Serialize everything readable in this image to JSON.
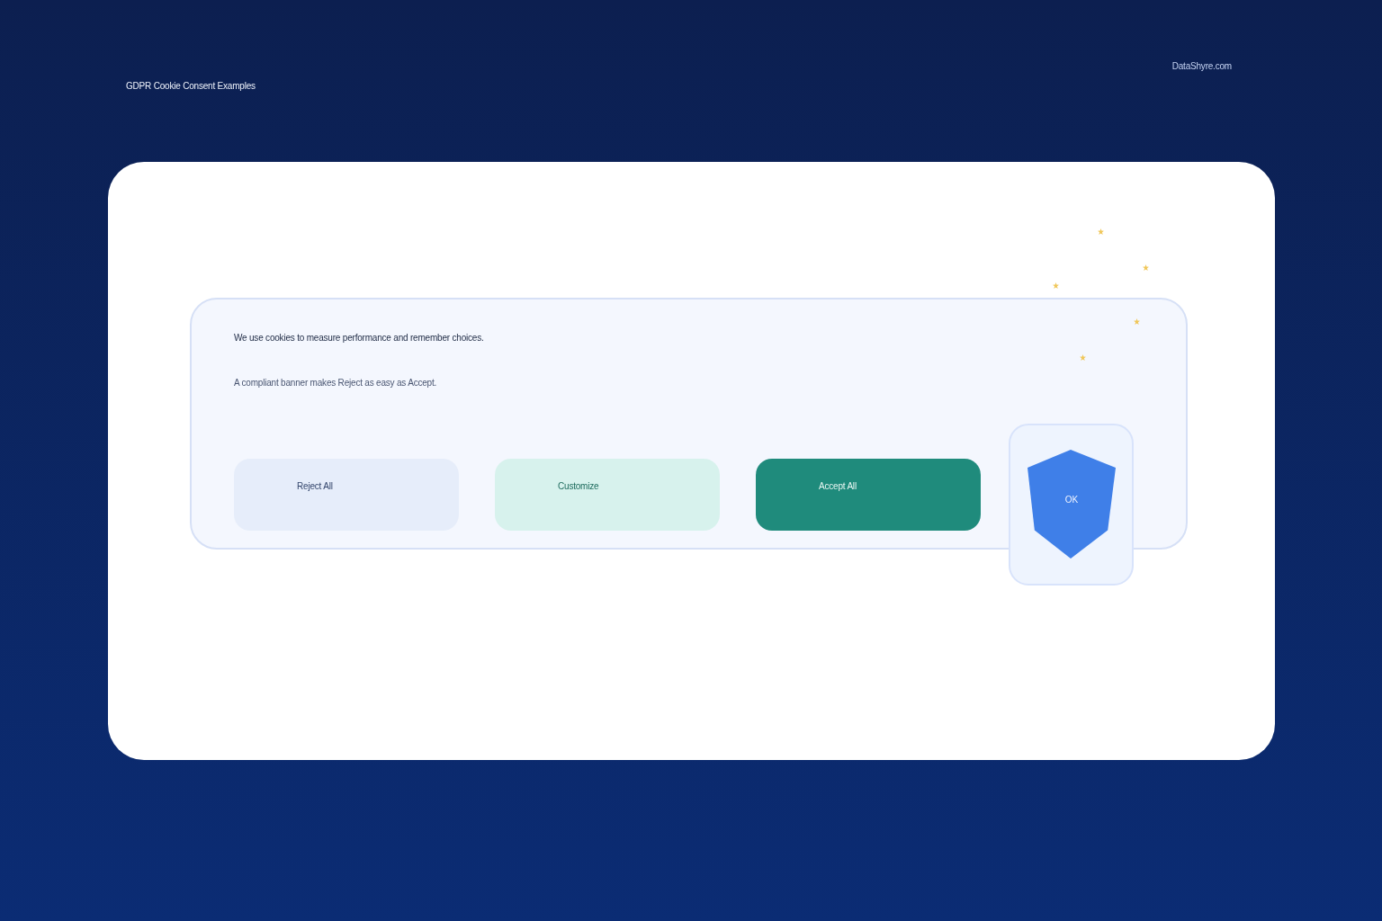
{
  "header": {
    "title": "GDPR Cookie Consent Examples",
    "site": "DataShyre.com"
  },
  "banner": {
    "message": "We use cookies to measure performance and remember choices.",
    "note": "A compliant banner makes Reject as easy as Accept.",
    "buttons": [
      {
        "label": "Reject All",
        "kind": "reject"
      },
      {
        "label": "Customize",
        "kind": "customize"
      },
      {
        "label": "Accept All",
        "kind": "accept"
      }
    ],
    "badge": {
      "label": "OK"
    }
  }
}
